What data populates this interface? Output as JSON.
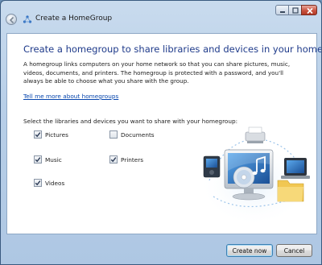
{
  "window": {
    "title": "Create a HomeGroup"
  },
  "main": {
    "heading": "Create a homegroup to share libraries and devices in your home",
    "description": "A homegroup links computers on your home network so that you can share pictures, music, videos, documents, and printers. The homegroup is protected with a password, and you'll always be able to choose what you share with the group.",
    "learn_more_link": "Tell me more about homegroups",
    "select_label": "Select the libraries and devices you want to share with your homegroup:",
    "options": [
      {
        "label": "Pictures",
        "checked": true
      },
      {
        "label": "Documents",
        "checked": false
      },
      {
        "label": "Music",
        "checked": true
      },
      {
        "label": "Printers",
        "checked": true
      },
      {
        "label": "Videos",
        "checked": true
      }
    ]
  },
  "footer": {
    "create_label": "Create now",
    "cancel_label": "Cancel"
  },
  "colors": {
    "heading": "#1e3a8a",
    "link": "#0645ad"
  }
}
